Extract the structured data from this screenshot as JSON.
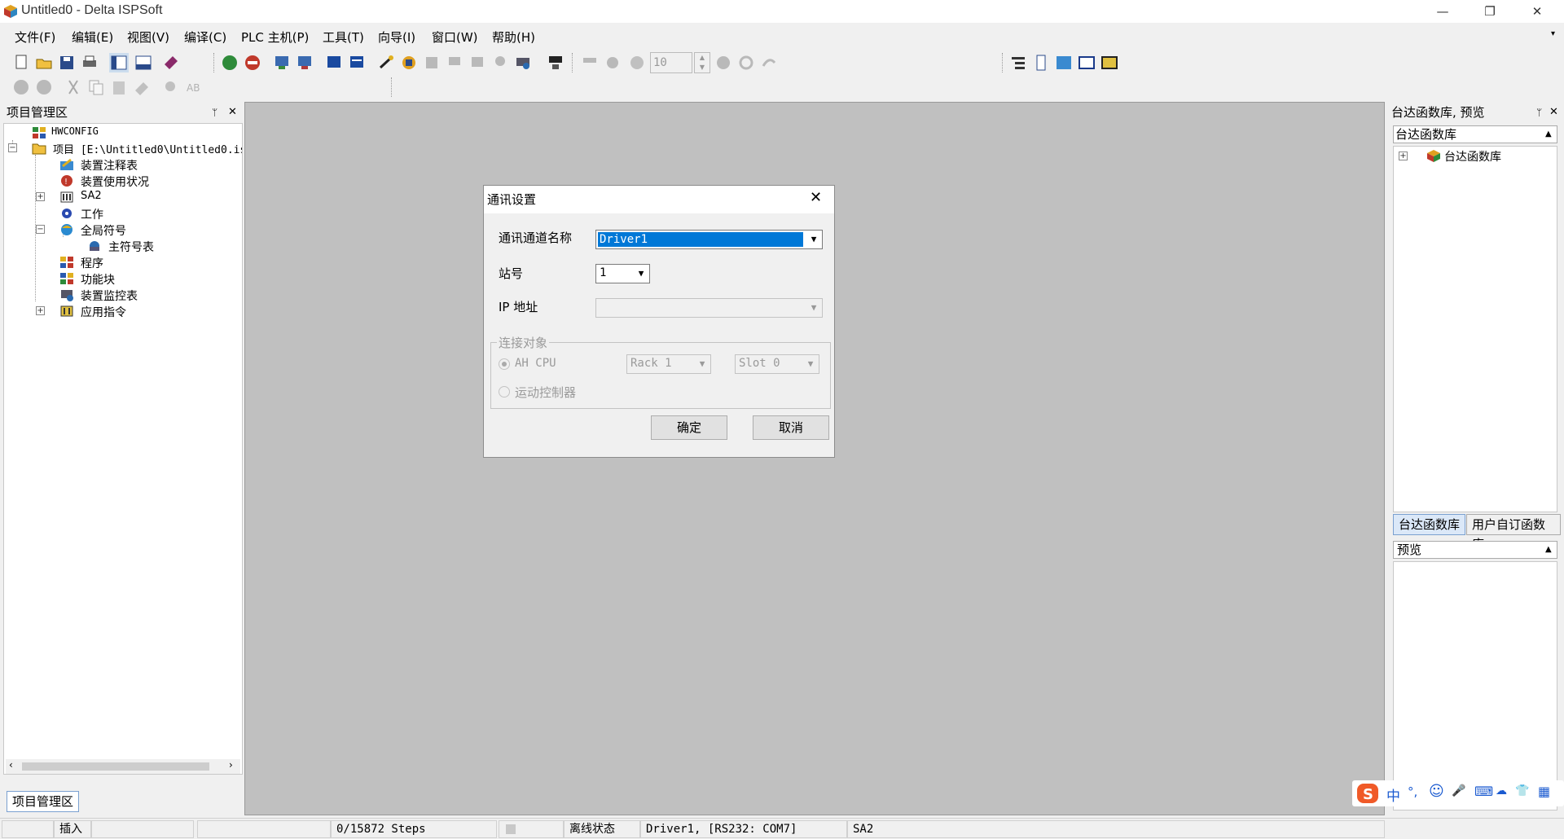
{
  "window": {
    "title": "Untitled0 - Delta ISPSoft",
    "minimize": "—",
    "restore": "❐",
    "close": "✕"
  },
  "menu": [
    "文件(F)",
    "编辑(E)",
    "视图(V)",
    "编译(C)",
    "PLC 主机(P)",
    "工具(T)",
    "向导(I)",
    "窗口(W)",
    "帮助(H)"
  ],
  "toolbar": {
    "counter_value": "10"
  },
  "project_panel": {
    "title": "项目管理区",
    "pin": "ᛘ",
    "close": "✕",
    "tab": "项目管理区",
    "items": [
      {
        "label": "HWCONFIG"
      },
      {
        "label": "项目 [E:\\Untitled0\\Untitled0.is"
      },
      {
        "label": "装置注释表"
      },
      {
        "label": "装置使用状况"
      },
      {
        "label": "SA2"
      },
      {
        "label": "工作"
      },
      {
        "label": "全局符号"
      },
      {
        "label": "主符号表"
      },
      {
        "label": "程序"
      },
      {
        "label": "功能块"
      },
      {
        "label": "装置监控表"
      },
      {
        "label": "应用指令"
      }
    ]
  },
  "library_panel": {
    "title": "台达函数库, 预览",
    "section": "台达函数库",
    "tree_root": "台达函数库",
    "tabs": [
      "台达函数库",
      "用户自订函数库"
    ],
    "preview": "预览"
  },
  "dialog": {
    "title": "通讯设置",
    "channel_label": "通讯通道名称",
    "channel_value": "Driver1",
    "station_label": "站号",
    "station_value": "1",
    "ip_label": "IP 地址",
    "ip_value": "",
    "group_label": "连接对象",
    "radio_ah": "AH CPU",
    "radio_motion": "运动控制器",
    "rack_value": "Rack 1",
    "slot_value": "Slot 0",
    "ok": "确定",
    "cancel": "取消"
  },
  "statusbar": {
    "mode": "插入",
    "steps": "0/15872 Steps",
    "state": "离线状态",
    "comm": "Driver1, [RS232: COM7]",
    "model": "SA2"
  },
  "ime": [
    "中",
    "°,",
    "☺",
    "🎤",
    "⌨",
    "👕",
    "▦"
  ],
  "colors": {
    "selection": "#0078d7",
    "mdi_background": "#c0c0c0"
  }
}
